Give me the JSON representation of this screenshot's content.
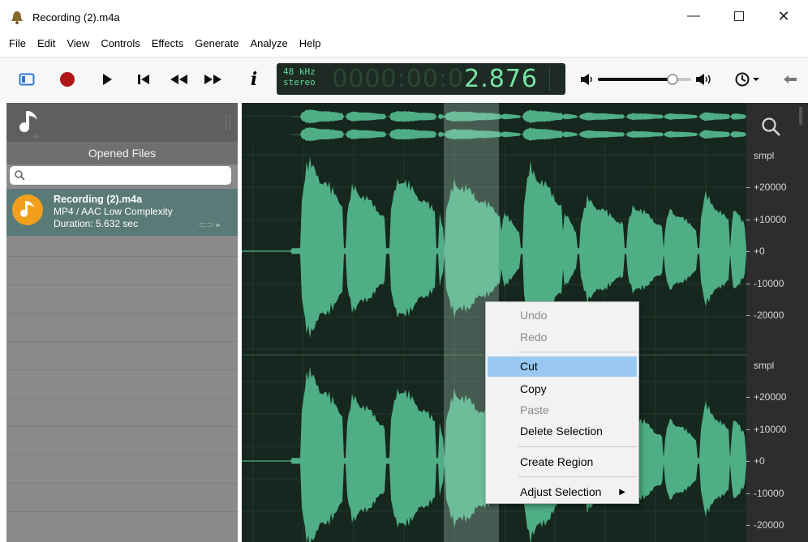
{
  "window": {
    "title": "Recording (2).m4a",
    "icons": [
      "app-bell-icon",
      "minimize-icon",
      "maximize-icon",
      "close-icon"
    ]
  },
  "menu": {
    "items": [
      "File",
      "Edit",
      "View",
      "Controls",
      "Effects",
      "Generate",
      "Analyze",
      "Help"
    ]
  },
  "toolbar": {
    "icons": [
      "sidebar-toggle-icon",
      "record-icon",
      "play-icon",
      "skip-to-start-icon",
      "rewind-icon",
      "fast-forward-icon",
      "info-icon",
      "volume-low-icon",
      "volume-high-icon",
      "clock-icon",
      "back-arrow-icon"
    ],
    "volume_level": 0.8
  },
  "display": {
    "sample_rate": "48 kHz",
    "channels": "stereo",
    "time_ghost": "0000:00:0",
    "time": "2.876"
  },
  "sidebar": {
    "panel_title": "Opened Files",
    "search_placeholder": "",
    "files": [
      {
        "name": "Recording (2).m4a",
        "format": "MP4 / AAC Low Complexity",
        "duration": "Duration: 5.632 sec"
      }
    ]
  },
  "ruler": {
    "unit": "smpl",
    "ticks": [
      "+20000",
      "+10000",
      "+0",
      "-10000",
      "-20000"
    ]
  },
  "context_menu": {
    "undo": "Undo",
    "redo": "Redo",
    "cut": "Cut",
    "copy": "Copy",
    "paste": "Paste",
    "delete": "Delete Selection",
    "create_region": "Create Region",
    "adjust": "Adjust Selection"
  },
  "colors": {
    "waveform": "#4fae85",
    "waveform_selected": "#6cc49a",
    "background": "#16271f",
    "accent_file_icon": "#f2a01c",
    "highlight": "#99c9f2",
    "record": "#b01515"
  }
}
